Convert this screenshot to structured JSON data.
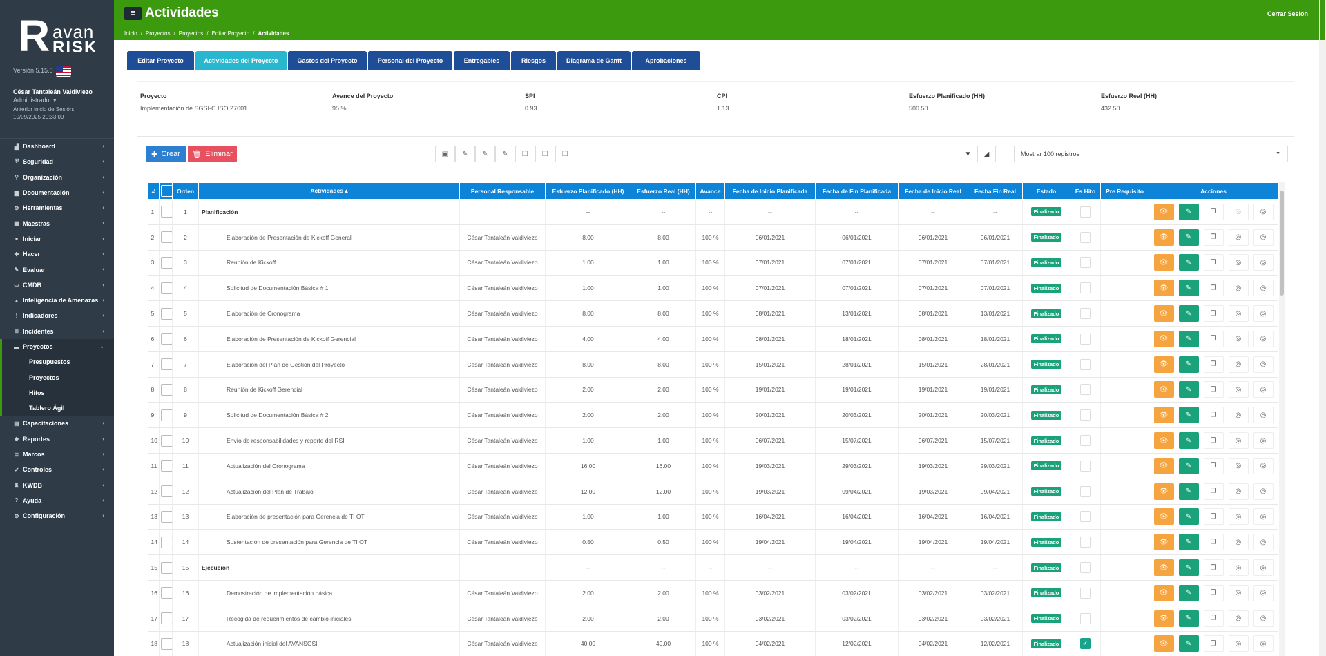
{
  "brand": {
    "logo_r": "R",
    "logo_avan": "avan",
    "logo_risk": "RISK",
    "version": "Versión 5.15.0"
  },
  "user": {
    "name": "César Tantaleán Valdiviezo",
    "role": "Administrador ▾",
    "last_login_label": "Anterior inicio de Sesión:",
    "last_login": "10/09/2025 20:33:09"
  },
  "menu": [
    {
      "label": "Dashboard",
      "icon": "chart-icon",
      "glyph": "▟"
    },
    {
      "label": "Seguridad",
      "icon": "shield-icon",
      "glyph": "⛨"
    },
    {
      "label": "Organización",
      "icon": "org-icon",
      "glyph": "⚲"
    },
    {
      "label": "Documentación",
      "icon": "folder-icon",
      "glyph": "▆"
    },
    {
      "label": "Herramientas",
      "icon": "gears-icon",
      "glyph": "⚙"
    },
    {
      "label": "Maestras",
      "icon": "grid-icon",
      "glyph": "▦"
    },
    {
      "label": "Iniciar",
      "icon": "dot-icon",
      "glyph": "●"
    },
    {
      "label": "Hacer",
      "icon": "plus-icon",
      "glyph": "✚"
    },
    {
      "label": "Evaluar",
      "icon": "edit-icon",
      "glyph": "✎"
    },
    {
      "label": "CMDB",
      "icon": "monitor-icon",
      "glyph": "▭"
    },
    {
      "label": "Inteligencia de Amenazas",
      "icon": "warning-icon",
      "glyph": "▲"
    },
    {
      "label": "Indicadores",
      "icon": "info-icon",
      "glyph": "!"
    },
    {
      "label": "Incidentes",
      "icon": "list-icon",
      "glyph": "≣"
    }
  ],
  "menu_active": {
    "label": "Proyectos",
    "icon": "briefcase-icon",
    "glyph": "▬"
  },
  "submenu": [
    "Presupuestos",
    "Proyectos",
    "Hitos",
    "Tablero Ágil"
  ],
  "menu_after": [
    {
      "label": "Capacitaciones",
      "icon": "book-icon",
      "glyph": "▤"
    },
    {
      "label": "Reportes",
      "icon": "tag-icon",
      "glyph": "◆"
    },
    {
      "label": "Marcos",
      "icon": "list-icon",
      "glyph": "≣"
    },
    {
      "label": "Controles",
      "icon": "check-icon",
      "glyph": "✔"
    },
    {
      "label": "KWDB",
      "icon": "graduation-icon",
      "glyph": "♜"
    },
    {
      "label": "Ayuda",
      "icon": "help-icon",
      "glyph": "?"
    },
    {
      "label": "Configuración",
      "icon": "gear-icon",
      "glyph": "⚙"
    }
  ],
  "header": {
    "title": "Actividades",
    "logout": "Cerrar Sesión",
    "toggle": "≡"
  },
  "breadcrumb": [
    "Inicio",
    "Proyectos",
    "Proyectos",
    "Editar Proyecto",
    "Actividades"
  ],
  "tabs": [
    {
      "label": "Editar Proyecto",
      "w": 97
    },
    {
      "label": "Actividades del Proyecto",
      "w": 132
    },
    {
      "label": "Gastos del Proyecto",
      "w": 114
    },
    {
      "label": "Personal del Proyecto",
      "w": 122
    },
    {
      "label": "Entregables",
      "w": 81
    },
    {
      "label": "Riesgos",
      "w": 65
    },
    {
      "label": "Diagrama de Gantt",
      "w": 106
    },
    {
      "label": "Aprobaciones",
      "w": 99
    }
  ],
  "summary": [
    {
      "label": "Proyecto",
      "value": "Implementación de SGSI-C ISO 27001"
    },
    {
      "label": "Avance del Proyecto",
      "value": "95 %"
    },
    {
      "label": "SPI",
      "value": "0.93"
    },
    {
      "label": "CPI",
      "value": "1.13"
    },
    {
      "label": "Esfuerzo Planificado (HH)",
      "value": "500.50"
    },
    {
      "label": "Esfuerzo Real (HH)",
      "value": "432.50"
    }
  ],
  "toolbar": {
    "create": "Crear",
    "delete": "Eliminar",
    "page_size": "Mostrar 100 registros"
  },
  "table": {
    "columns": [
      "#",
      "",
      "Orden",
      "Actividades ▴",
      "Personal Responsable",
      "Esfuerzo Planificado (HH)",
      "Esfuerzo Real (HH)",
      "Avance",
      "Fecha de Inicio Planificada",
      "Fecha de Fin Planificada",
      "Fecha de Inicio Real",
      "Fecha Fin Real",
      "Estado",
      "Es Hito",
      "Pre Requisito",
      "Acciones"
    ],
    "rows": [
      [
        "1",
        "1",
        "Planificación",
        "César Tantaleán Valdiviezo",
        "--",
        "--",
        "--",
        "--",
        "--",
        "--",
        "--",
        "Finalizado",
        false,
        "",
        true
      ],
      [
        "2",
        "2",
        "Elaboración de Presentación de Kickoff General",
        "César Tantaleán Valdiviezo",
        "8.00",
        "8.00",
        "100 %",
        "06/01/2021",
        "06/01/2021",
        "06/01/2021",
        "06/01/2021",
        "Finalizado",
        false,
        "",
        false
      ],
      [
        "3",
        "3",
        "Reunión de Kickoff",
        "César Tantaleán Valdiviezo",
        "1.00",
        "1.00",
        "100 %",
        "07/01/2021",
        "07/01/2021",
        "07/01/2021",
        "07/01/2021",
        "Finalizado",
        false,
        "",
        false
      ],
      [
        "4",
        "4",
        "Solicitud de Documentación Básica # 1",
        "César Tantaleán Valdiviezo",
        "1.00",
        "1.00",
        "100 %",
        "07/01/2021",
        "07/01/2021",
        "07/01/2021",
        "07/01/2021",
        "Finalizado",
        false,
        "",
        false
      ],
      [
        "5",
        "5",
        "Elaboración de Cronograma",
        "César Tantaleán Valdiviezo",
        "8.00",
        "8.00",
        "100 %",
        "08/01/2021",
        "13/01/2021",
        "08/01/2021",
        "13/01/2021",
        "Finalizado",
        false,
        "",
        false
      ],
      [
        "6",
        "6",
        "Elaboración de Presentación de Kickoff Gerencial",
        "César Tantaleán Valdiviezo",
        "4.00",
        "4.00",
        "100 %",
        "08/01/2021",
        "18/01/2021",
        "08/01/2021",
        "18/01/2021",
        "Finalizado",
        false,
        "",
        false
      ],
      [
        "7",
        "7",
        "Elaboración del Plan de Gestión del Proyecto",
        "César Tantaleán Valdiviezo",
        "8.00",
        "8.00",
        "100 %",
        "15/01/2021",
        "28/01/2021",
        "15/01/2021",
        "28/01/2021",
        "Finalizado",
        false,
        "",
        false
      ],
      [
        "8",
        "8",
        "Reunión de Kickoff Gerencial",
        "César Tantaleán Valdiviezo",
        "2.00",
        "2.00",
        "100 %",
        "19/01/2021",
        "19/01/2021",
        "19/01/2021",
        "19/01/2021",
        "Finalizado",
        false,
        "",
        false
      ],
      [
        "9",
        "9",
        "Solicitud de Documentación Básica # 2",
        "César Tantaleán Valdiviezo",
        "2.00",
        "2.00",
        "100 %",
        "20/01/2021",
        "20/03/2021",
        "20/01/2021",
        "20/03/2021",
        "Finalizado",
        false,
        "",
        false
      ],
      [
        "10",
        "10",
        "Envío de responsabilidades y reporte del RSI",
        "César Tantaleán Valdiviezo",
        "1.00",
        "1.00",
        "100 %",
        "06/07/2021",
        "15/07/2021",
        "06/07/2021",
        "15/07/2021",
        "Finalizado",
        false,
        "",
        false
      ],
      [
        "11",
        "11",
        "Actualización del Cronograma",
        "César Tantaleán Valdiviezo",
        "16.00",
        "16.00",
        "100 %",
        "19/03/2021",
        "29/03/2021",
        "19/03/2021",
        "29/03/2021",
        "Finalizado",
        false,
        "",
        false
      ],
      [
        "12",
        "12",
        "Actualización del Plan de Trabajo",
        "César Tantaleán Valdiviezo",
        "12.00",
        "12.00",
        "100 %",
        "19/03/2021",
        "09/04/2021",
        "19/03/2021",
        "09/04/2021",
        "Finalizado",
        false,
        "",
        false
      ],
      [
        "13",
        "13",
        "Elaboración de presentación para Gerencia de TI OT",
        "César Tantaleán Valdiviezo",
        "1.00",
        "1.00",
        "100 %",
        "16/04/2021",
        "16/04/2021",
        "16/04/2021",
        "16/04/2021",
        "Finalizado",
        false,
        "",
        false
      ],
      [
        "14",
        "14",
        "Sustentación de presentación para Gerencia de TI OT",
        "César Tantaleán Valdiviezo",
        "0.50",
        "0.50",
        "100 %",
        "19/04/2021",
        "19/04/2021",
        "19/04/2021",
        "19/04/2021",
        "Finalizado",
        false,
        "",
        false
      ],
      [
        "15",
        "15",
        "Ejecución",
        "César Tantaleán Valdiviezo",
        "--",
        "--",
        "--",
        "--",
        "--",
        "--",
        "--",
        "Finalizado",
        false,
        "",
        false
      ],
      [
        "16",
        "16",
        "Demostración de implementación básica",
        "César Tantaleán Valdiviezo",
        "2.00",
        "2.00",
        "100 %",
        "03/02/2021",
        "03/02/2021",
        "03/02/2021",
        "03/02/2021",
        "Finalizado",
        false,
        "",
        false
      ],
      [
        "17",
        "17",
        "Recogida de requerimientos de cambio iniciales",
        "César Tantaleán Valdiviezo",
        "2.00",
        "2.00",
        "100 %",
        "03/02/2021",
        "03/02/2021",
        "03/02/2021",
        "03/02/2021",
        "Finalizado",
        false,
        "",
        false
      ],
      [
        "18",
        "18",
        "Actualización inicial del AVANSGSI",
        "César Tantaleán Valdiviezo",
        "40.00",
        "40.00",
        "100 %",
        "04/02/2021",
        "12/02/2021",
        "04/02/2021",
        "12/02/2021",
        "Finalizado",
        true,
        "",
        false
      ]
    ],
    "phase_rows": [
      0,
      14
    ],
    "responsable_phase_visible": [
      false,
      false
    ]
  },
  "colors": {
    "brand_green": "#3c9a0f",
    "sidebar": "#2f3c48",
    "tab_blue": "#1f4e98",
    "tab_active": "#29b7cf",
    "header_blue": "#0e84d9",
    "badge_green": "#1aa37a",
    "view_orange": "#f6a440",
    "delete_red": "#e7515f"
  }
}
